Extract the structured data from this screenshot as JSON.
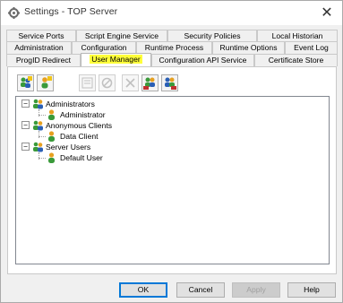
{
  "window": {
    "title": "Settings - TOP Server",
    "close_glyph": "✕"
  },
  "tabs": {
    "row1": [
      "Service Ports",
      "Script Engine Service",
      "Security Policies",
      "Local Historian"
    ],
    "row2": [
      "Administration",
      "Configuration",
      "Runtime Process",
      "Runtime Options",
      "Event Log"
    ],
    "row3": [
      "ProgID Redirect",
      "User Manager",
      "Configuration API Service",
      "Certificate Store"
    ],
    "active": "User Manager",
    "highlight_color": "#ffff3a"
  },
  "toolbar": {
    "buttons": [
      {
        "name": "add-group-icon",
        "enabled": true
      },
      {
        "name": "add-user-icon",
        "enabled": true
      },
      {
        "name": "properties-icon",
        "enabled": false
      },
      {
        "name": "disable-icon",
        "enabled": false
      },
      {
        "name": "delete-icon",
        "enabled": false
      },
      {
        "name": "import-users-icon",
        "enabled": true
      },
      {
        "name": "export-users-icon",
        "enabled": true
      }
    ]
  },
  "tree": {
    "groups": [
      {
        "label": "Administrators",
        "expanded": true,
        "users": [
          "Administrator"
        ]
      },
      {
        "label": "Anonymous Clients",
        "expanded": true,
        "users": [
          "Data Client"
        ]
      },
      {
        "label": "Server Users",
        "expanded": true,
        "users": [
          "Default User"
        ]
      }
    ],
    "expander_glyph": "−"
  },
  "buttons": {
    "ok": "OK",
    "cancel": "Cancel",
    "apply": "Apply",
    "help": "Help"
  },
  "colors": {
    "accent": "#0078d7",
    "group_icon_green": "#3a9a3a",
    "group_icon_blue": "#2a5fb5",
    "user_icon_orange": "#e6a020"
  }
}
